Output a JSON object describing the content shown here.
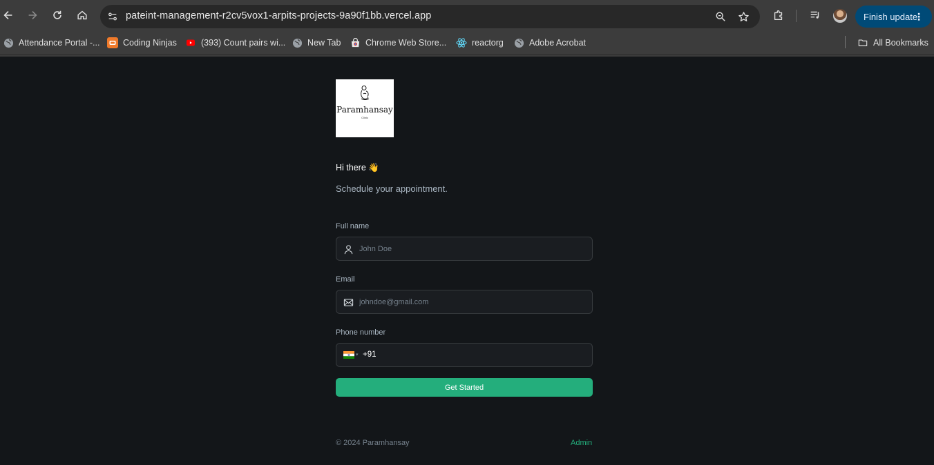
{
  "browser": {
    "url": "pateint-management-r2cv5vox1-arpits-projects-9a90f1bb.vercel.app",
    "finish_update_label": "Finish update",
    "bookmarks": [
      {
        "label": "Attendance Portal -...",
        "icon": "globe-icon"
      },
      {
        "label": "Coding Ninjas",
        "icon": "coding-ninjas-icon"
      },
      {
        "label": "(393) Count pairs wi...",
        "icon": "youtube-icon"
      },
      {
        "label": "New Tab",
        "icon": "globe-icon"
      },
      {
        "label": "Chrome Web Store...",
        "icon": "chrome-web-store-icon"
      },
      {
        "label": "reactorg",
        "icon": "react-icon"
      },
      {
        "label": "Adobe Acrobat",
        "icon": "globe-icon"
      }
    ],
    "all_bookmarks_label": "All Bookmarks"
  },
  "logo": {
    "brand": "Paramhansay",
    "sub": "Clinic"
  },
  "header": {
    "greeting": "Hi there 👋",
    "subtitle": "Schedule your appointment."
  },
  "form": {
    "full_name": {
      "label": "Full name",
      "placeholder": "John Doe",
      "value": ""
    },
    "email": {
      "label": "Email",
      "placeholder": "johndoe@gmail.com",
      "value": ""
    },
    "phone": {
      "label": "Phone number",
      "country": "India",
      "code": "+91"
    },
    "submit_label": "Get Started"
  },
  "footer": {
    "copyright": "© 2024 Paramhansay",
    "admin_link": "Admin"
  },
  "colors": {
    "background": "#131619",
    "accent": "#24ae7c",
    "input_bg": "#1a1d21",
    "muted_text": "#abb8c4"
  }
}
